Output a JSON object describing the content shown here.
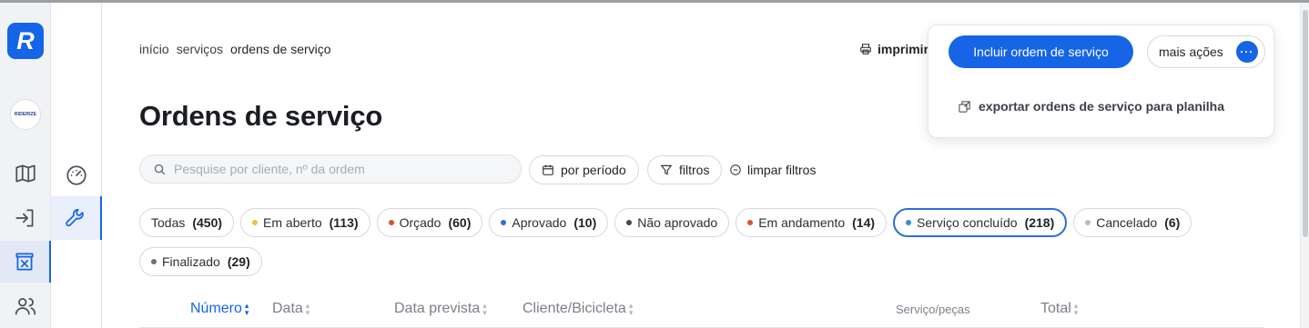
{
  "rail": {
    "logo_letter": "R",
    "brand_text": "RIDERIZE",
    "items": [
      {
        "icon": "map-icon"
      },
      {
        "icon": "login-icon"
      },
      {
        "icon": "store-icon",
        "active": true
      },
      {
        "icon": "users-icon"
      }
    ]
  },
  "sidebar2": {
    "items": [
      {
        "icon": "dashboard-gauge-icon"
      },
      {
        "icon": "wrench-icon",
        "active": true
      }
    ]
  },
  "breadcrumb": [
    "início",
    "serviços",
    "ordens de serviço"
  ],
  "header": {
    "print_label": "imprimir",
    "title": "Ordens de serviço",
    "primary_button": "Incluir ordem de serviço",
    "more_actions": "mais ações",
    "menu_item": "exportar ordens de serviço para planilha"
  },
  "search": {
    "placeholder": "Pesquise por cliente, nº da ordem",
    "value": ""
  },
  "filters": {
    "period": "por período",
    "filters": "filtros",
    "clear": "limpar filtros"
  },
  "status_chips": [
    {
      "label": "Todas",
      "count": "(450)",
      "color": ""
    },
    {
      "label": "Em aberto",
      "count": "(113)",
      "color": "#e8c246"
    },
    {
      "label": "Orçado",
      "count": "(60)",
      "color": "#d2552f"
    },
    {
      "label": "Aprovado",
      "count": "(10)",
      "color": "#2f6fd8"
    },
    {
      "label": "Não aprovado",
      "count": "",
      "color": "#444a52"
    },
    {
      "label": "Em andamento",
      "count": "(14)",
      "color": "#d2552f"
    },
    {
      "label": "Serviço concluído",
      "count": "(218)",
      "color": "#2f8fd8",
      "active": true
    },
    {
      "label": "Cancelado",
      "count": "(6)",
      "color": "#b8bcc2"
    },
    {
      "label": "Finalizado",
      "count": "(29)",
      "color": "#6b7178"
    }
  ],
  "table": {
    "columns": [
      "Número",
      "Data",
      "Data prevista",
      "Cliente/Bicicleta",
      "Serviço/peças",
      "Total"
    ]
  },
  "colors": {
    "accent": "#1565e6"
  }
}
